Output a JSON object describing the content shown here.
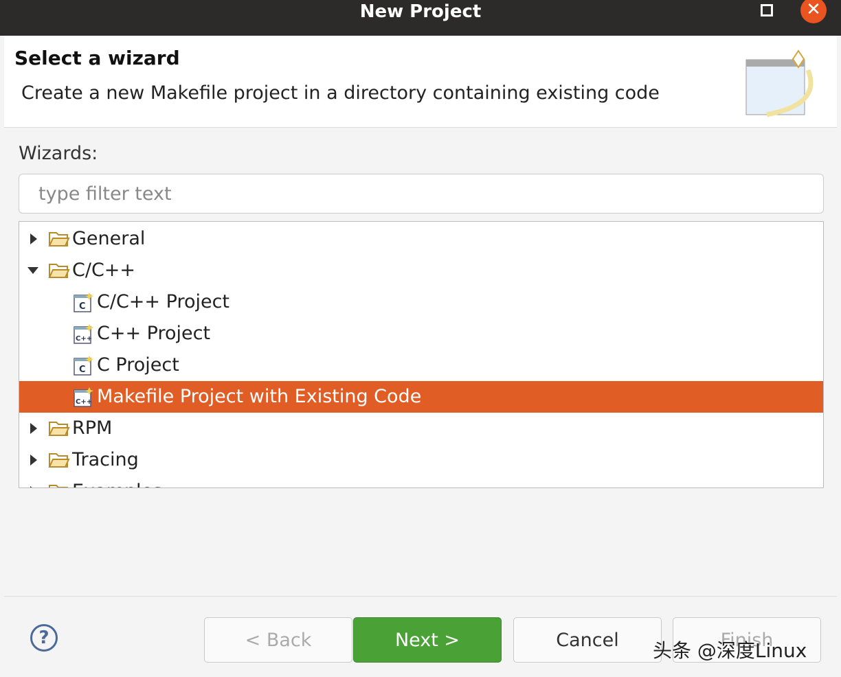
{
  "window": {
    "title": "New Project",
    "maximize_icon": "square-icon",
    "close_icon": "close-icon"
  },
  "header": {
    "title": "Select a wizard",
    "description": "Create a new Makefile project in a directory containing existing code"
  },
  "wizards": {
    "label": "Wizards:",
    "filter_placeholder": "type filter text",
    "filter_value": ""
  },
  "tree": [
    {
      "label": "General",
      "type": "folder",
      "expanded": false,
      "level": 0
    },
    {
      "label": "C/C++",
      "type": "folder",
      "expanded": true,
      "level": 0
    },
    {
      "label": "C/C++ Project",
      "type": "c-project",
      "level": 1
    },
    {
      "label": "C++ Project",
      "type": "cpp-project",
      "level": 1
    },
    {
      "label": "C Project",
      "type": "c-project",
      "level": 1
    },
    {
      "label": "Makefile Project with Existing Code",
      "type": "cpp-project",
      "level": 1,
      "selected": true
    },
    {
      "label": "RPM",
      "type": "folder",
      "expanded": false,
      "level": 0
    },
    {
      "label": "Tracing",
      "type": "folder",
      "expanded": false,
      "level": 0
    },
    {
      "label": "Examples",
      "type": "folder",
      "expanded": false,
      "level": 0
    }
  ],
  "buttons": {
    "help": "?",
    "back": "< Back",
    "next": "Next >",
    "cancel": "Cancel",
    "finish": "Finish"
  },
  "watermark": "头条 @深度Linux",
  "colors": {
    "selection": "#e05d25",
    "primary": "#4aa136",
    "close": "#e95420"
  }
}
